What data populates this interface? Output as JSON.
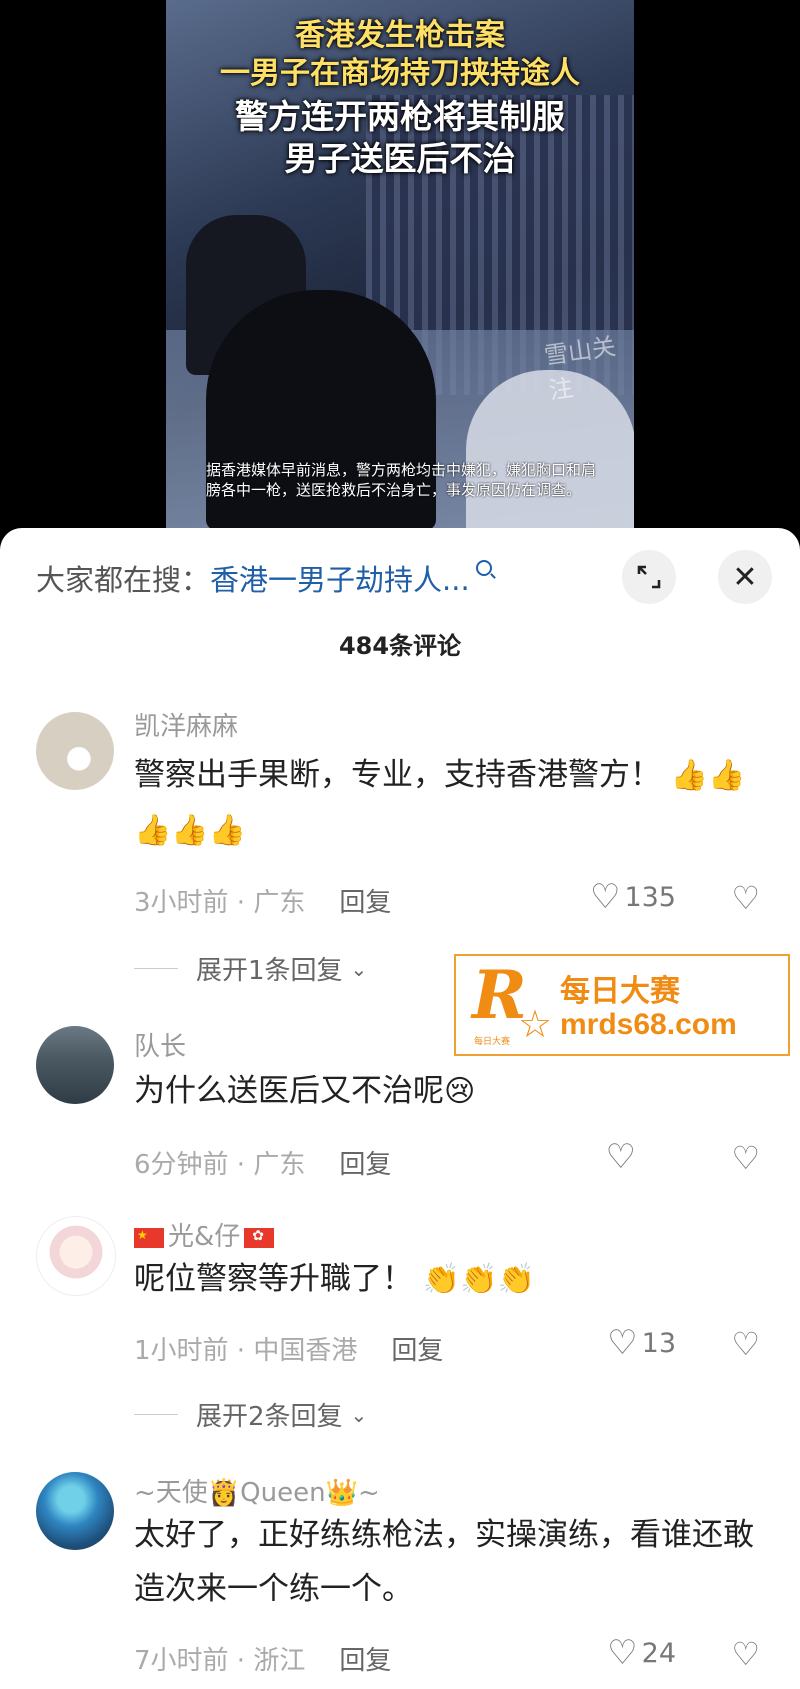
{
  "video": {
    "headline_line1": "香港发生枪击案",
    "headline_line2": "一男子在商场持刀挟持途人",
    "headline_line3": "警方连开两枪将其制服",
    "headline_line4": "男子送医后不治",
    "watermark": "雪山关注",
    "caption": "据香港媒体早前消息，警方两枪均击中嫌犯，嫌犯胸口和肩膀各中一枪，送医抢救后不治身亡，事发原因仍在调查。"
  },
  "search": {
    "prefix": "大家都在搜：",
    "term": "香港一男子劫持人...",
    "search_icon": "search-icon"
  },
  "comment_count_label": "484条评论",
  "comments": [
    {
      "username": "凯洋麻麻",
      "text": "警察出手果断，专业，支持香港警方！",
      "emojis": "👍👍👍👍👍",
      "time_location": "3小时前 · 广东",
      "reply_label": "回复",
      "likes": "135",
      "expand": "展开1条回复"
    },
    {
      "username": "队长",
      "text": "为什么送医后又不治呢",
      "emojis": "😢",
      "time_location": "6分钟前 · 广东",
      "reply_label": "回复",
      "likes": ""
    },
    {
      "username": "光&仔",
      "text": "呢位警察等升職了！",
      "emojis": "👏👏👏",
      "time_location": "1小时前 · 中国香港",
      "reply_label": "回复",
      "likes": "13",
      "expand": "展开2条回复"
    },
    {
      "username": "~天使👸Queen👑~",
      "text": "太好了，正好练练枪法，实操演练，看谁还敢造次来一个练一个。",
      "emojis": "",
      "time_location": "7小时前 · 浙江",
      "reply_label": "回复",
      "likes": "24"
    }
  ],
  "ad": {
    "logo_letter": "R",
    "logo_small": "每日大赛",
    "title": "每日大赛",
    "domain": "mrds68.com"
  },
  "colors": {
    "search_term": "#1f5ea8",
    "ad_orange": "#f08c14"
  }
}
